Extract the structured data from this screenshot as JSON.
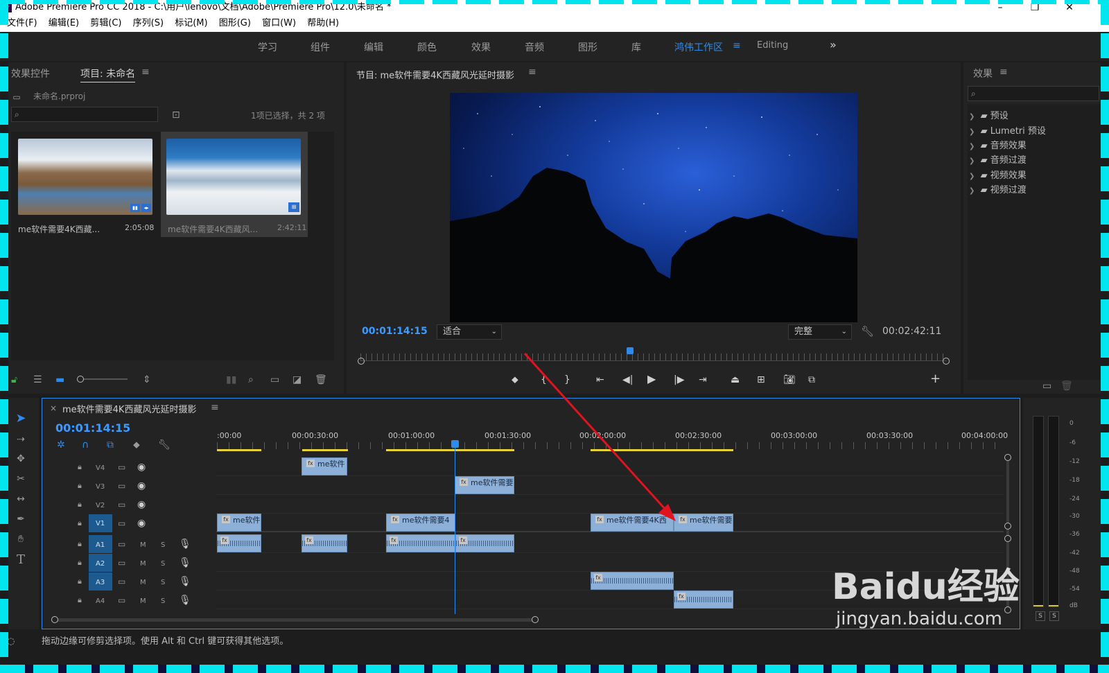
{
  "window": {
    "title": "Adobe Premiere Pro CC 2018 - C:\\用户\\lenovo\\文档\\Adobe\\Premiere Pro\\12.0\\未命名 *",
    "logo": "Pr"
  },
  "menu": [
    "文件(F)",
    "编辑(E)",
    "剪辑(C)",
    "序列(S)",
    "标记(M)",
    "图形(G)",
    "窗口(W)",
    "帮助(H)"
  ],
  "workspaces": {
    "items": [
      "学习",
      "组件",
      "编辑",
      "颜色",
      "效果",
      "音频",
      "图形",
      "库"
    ],
    "active": "鸿伟工作区",
    "extra": "Editing",
    "more": "»"
  },
  "project_panel": {
    "tab_effects_controls": "效果控件",
    "tab_project": "项目: 未命名",
    "project_file": "未命名.prproj",
    "selection_info": "1项已选择，共 2 项",
    "clips": [
      {
        "name": "me软件需要4K西藏...",
        "duration": "2:05:08"
      },
      {
        "name": "me软件需要4K西藏风...",
        "duration": "2:42:11"
      }
    ]
  },
  "program_monitor": {
    "title": "节目: me软件需要4K西藏风光延时摄影",
    "timecode": "00:01:14:15",
    "fit": "适合",
    "quality": "完整",
    "duration": "00:02:42:11",
    "playhead_fraction": 0.46
  },
  "effects_panel": {
    "title": "效果",
    "items": [
      "预设",
      "Lumetri 预设",
      "音频效果",
      "音频过渡",
      "视频效果",
      "视频过渡"
    ]
  },
  "timeline": {
    "sequence_name": "me软件需要4K西藏风光延时摄影",
    "timecode": "00:01:14:15",
    "ruler": [
      ":00:00",
      "00:00:30:00",
      "00:01:00:00",
      "00:01:30:00",
      "00:02:00:00",
      "00:02:30:00",
      "00:03:00:00",
      "00:03:30:00",
      "00:04:00:00"
    ],
    "video_tracks": [
      "V4",
      "V3",
      "V2",
      "V1"
    ],
    "audio_tracks": [
      "A1",
      "A2",
      "A3",
      "A4"
    ],
    "track_buttons": {
      "mute": "M",
      "solo": "S"
    },
    "clip_label": "me软件",
    "clip_label_2": "me软件需要",
    "clip_label_3": "me软件需要4",
    "clip_label_4": "me软件需要4K西",
    "clip_label_5": "me软件需要",
    "fx": "fx"
  },
  "audio_meter": {
    "scale": [
      "0",
      "-6",
      "-12",
      "-18",
      "-24",
      "-30",
      "-36",
      "-42",
      "-48",
      "-54",
      "dB"
    ],
    "solo": [
      "S",
      "S"
    ]
  },
  "status": {
    "hint": "拖动边缘可修剪选择项。使用 Alt 和 Ctrl 键可获得其他选项。"
  },
  "watermark": {
    "brand": "Baidu经验",
    "url": "jingyan.baidu.com"
  },
  "colors": {
    "accent": "#2d8ceb",
    "clip": "#8db0d9",
    "arrow": "#e0141e",
    "border_dash": "#00e5ee"
  }
}
